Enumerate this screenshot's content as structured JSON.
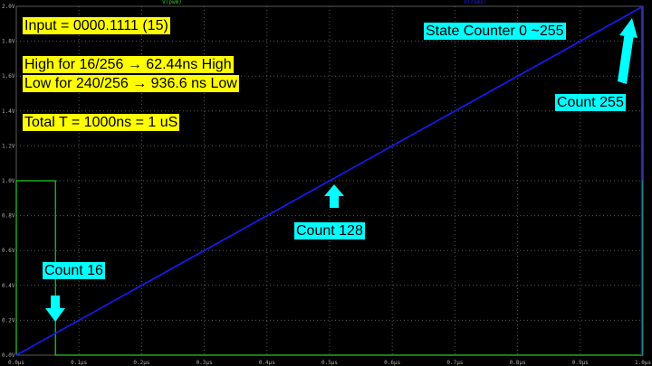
{
  "chart_data": {
    "type": "line",
    "x_ticks": [
      "0.0µs",
      "0.1µs",
      "0.2µs",
      "0.3µs",
      "0.4µs",
      "0.5µs",
      "0.6µs",
      "0.7µs",
      "0.8µs",
      "0.9µs",
      "1.0µs"
    ],
    "y_ticks": [
      "0.0V",
      "0.2V",
      "0.4V",
      "0.6V",
      "0.8V",
      "1.0V",
      "1.2V",
      "1.4V",
      "1.6V",
      "1.8V",
      "2.0V"
    ],
    "xlim": [
      0,
      1.0
    ],
    "ylim": [
      0,
      2.0
    ],
    "xunit": "µs",
    "yunit": "V",
    "grid": true,
    "series": [
      {
        "name": "V(pwm)",
        "color": "#22cc22",
        "x": [
          0,
          0,
          0.0625,
          0.0625,
          0.9992,
          0.9992,
          1.0
        ],
        "y": [
          0,
          1.0,
          1.0,
          0,
          0,
          1.0,
          1.0
        ]
      },
      {
        "name": "V(ramp)",
        "color": "#1a1aff",
        "x": [
          0,
          0.998,
          0.998
        ],
        "y": [
          0,
          1.996,
          0
        ]
      }
    ],
    "legend": [
      "V(pwm)",
      "V(ramp)"
    ]
  },
  "annotations": {
    "input": "Input = 0000.1111 (15)",
    "high": "High for 16/256 → 62.44ns High",
    "low": "Low for 240/256 → 936.6 ns Low",
    "total": "Total T = 1000ns = 1 uS",
    "state_counter": "State Counter 0 ~255",
    "count_16": "Count 16",
    "count_128": "Count 128",
    "count_255": "Count 255"
  },
  "colors": {
    "background": "#000000",
    "grid": "#5a5a5a",
    "axis_text": "#b0b0b0",
    "arrow": "#00ffff",
    "yellow_note": "#ffff00",
    "cyan_note": "#00ffff"
  }
}
